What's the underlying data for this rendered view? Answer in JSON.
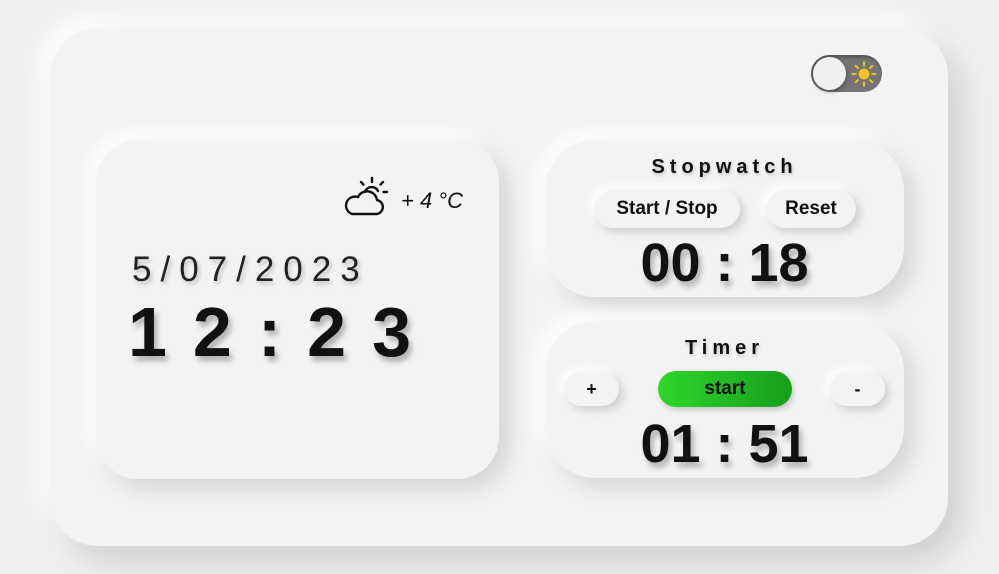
{
  "theme_toggle": {
    "icon": "sun-icon",
    "state": "light"
  },
  "clock": {
    "weather_icon": "partly-cloudy-icon",
    "temperature": "+ 4 °C",
    "date": "5/07/2023",
    "time": "12:23"
  },
  "stopwatch": {
    "title": "Stopwatch",
    "start_stop_label": "Start / Stop",
    "reset_label": "Reset",
    "readout": "00 : 18"
  },
  "timer": {
    "title": "Timer",
    "plus_label": "+",
    "start_label": "start",
    "minus_label": "-",
    "readout": "01 : 51"
  },
  "colors": {
    "background": "#f3f3f3",
    "toggle_track": "#757575",
    "sun": "#f6c21c",
    "start_green_from": "#2fd62a",
    "start_green_to": "#169e1d",
    "text": "#111111"
  }
}
